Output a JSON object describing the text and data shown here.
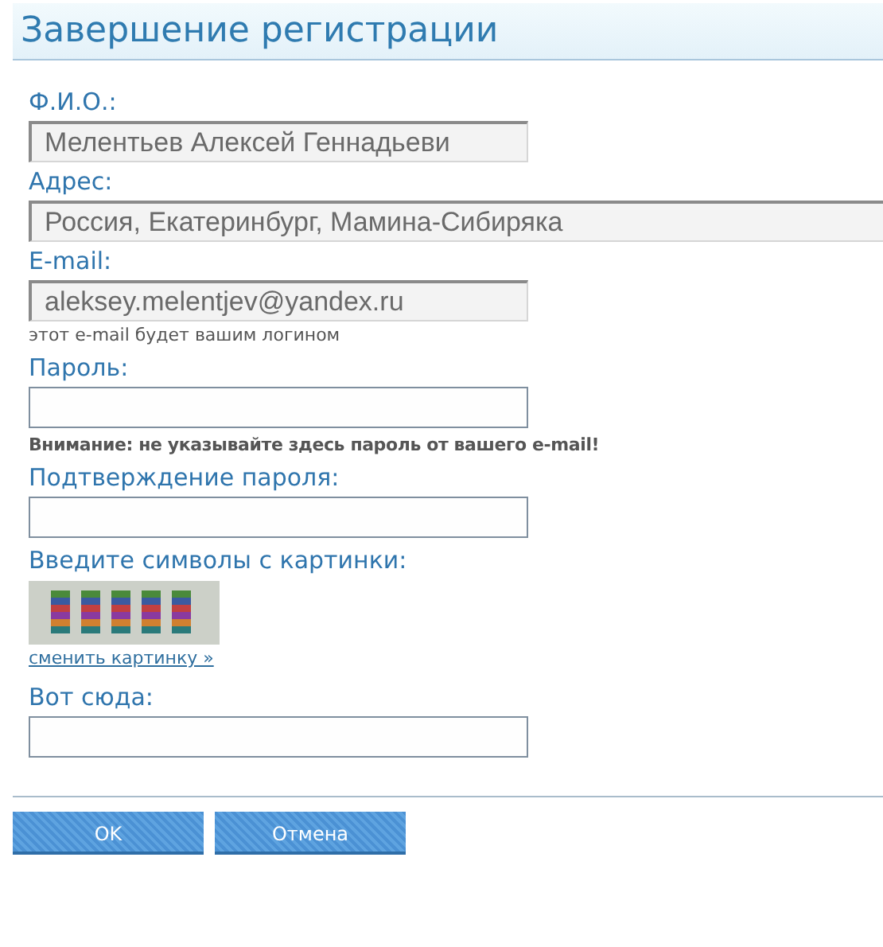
{
  "title": "Завершение регистрации",
  "fields": [
    {
      "label": "Ф.И.О.:",
      "kind": "readonly",
      "value": "Мелентьев Алексей Геннадьеви"
    },
    {
      "label": "Адрес:",
      "kind": "readonly-long",
      "value": "Россия, Екатеринбург, Мамина-Сибиряка"
    },
    {
      "label": "E-mail:",
      "kind": "readonly",
      "value": "aleksey.melentjev@yandex.ru",
      "note": {
        "kind": "hint",
        "text": "этот e-mail будет вашим логином"
      }
    },
    {
      "label": "Пароль:",
      "kind": "empty",
      "note": {
        "kind": "warning",
        "text": "Внимание: не указывайте здесь пароль от вашего e-mail!"
      }
    },
    {
      "label": "Подтверждение пароля:",
      "kind": "empty"
    },
    {
      "label": "Введите символы с картинки:",
      "kind": "captcha",
      "link": "сменить картинку »"
    },
    {
      "label": "Вот сюда:",
      "kind": "empty"
    }
  ],
  "buttons": [
    "OK",
    "Отмена"
  ]
}
